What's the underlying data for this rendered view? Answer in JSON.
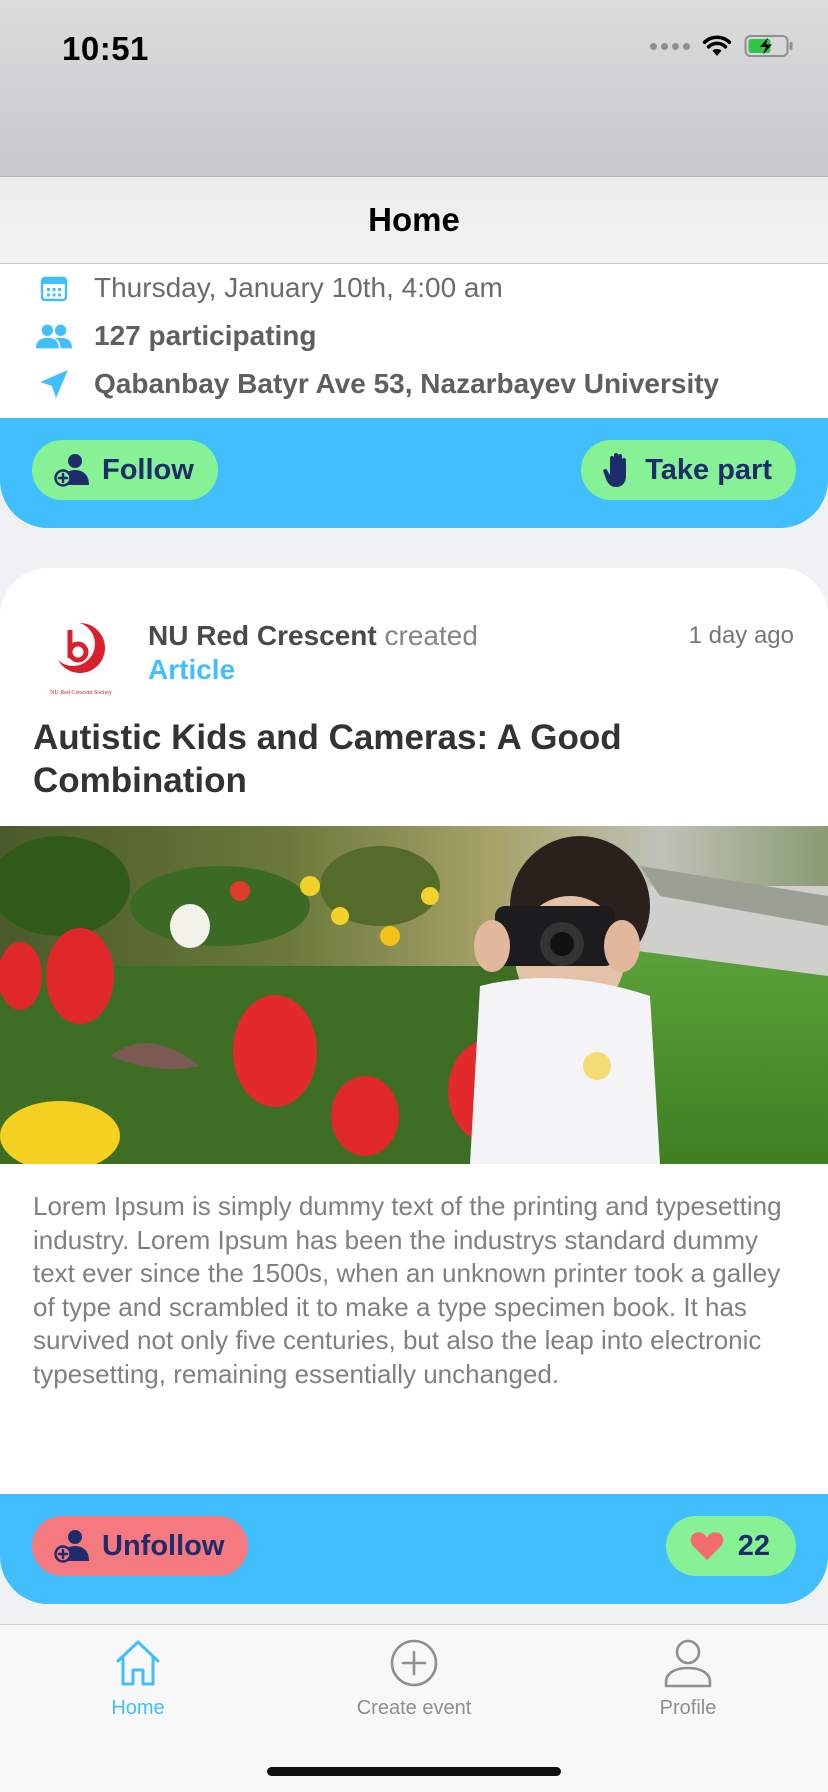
{
  "status_bar": {
    "time": "10:51"
  },
  "nav": {
    "title": "Home"
  },
  "event": {
    "date": "Thursday, January 10th, 4:00 am",
    "participants": "127 participating",
    "location": "Qabanbay Batyr Ave 53, Nazarbayev University",
    "follow_label": "Follow",
    "take_part_label": "Take part"
  },
  "article": {
    "org_name": "NU Red Crescent",
    "action_text": " created",
    "content_type": "Article",
    "time_ago": "1 day ago",
    "logo_caption": "NU Red Crescent Society",
    "title": "Autistic Kids and Cameras: A Good Combination",
    "body": "Lorem Ipsum is simply dummy text of the printing and typesetting industry. Lorem Ipsum has been the industrys standard dummy text ever since the 1500s, when an unknown printer took a galley of type and scrambled it to make a type specimen book. It has survived not only five centuries, but also the leap into electronic typesetting, remaining essentially unchanged.",
    "unfollow_label": "Unfollow",
    "likes": "22"
  },
  "tabs": [
    {
      "label": "Home",
      "icon": "home-icon",
      "active": true
    },
    {
      "label": "Create event",
      "icon": "plus-circle-icon",
      "active": false
    },
    {
      "label": "Profile",
      "icon": "person-icon",
      "active": false
    }
  ],
  "colors": {
    "accent": "#41bffc",
    "green_pill": "#86f295",
    "red_pill": "#f57a7f",
    "pill_text": "#1f2c6b"
  }
}
